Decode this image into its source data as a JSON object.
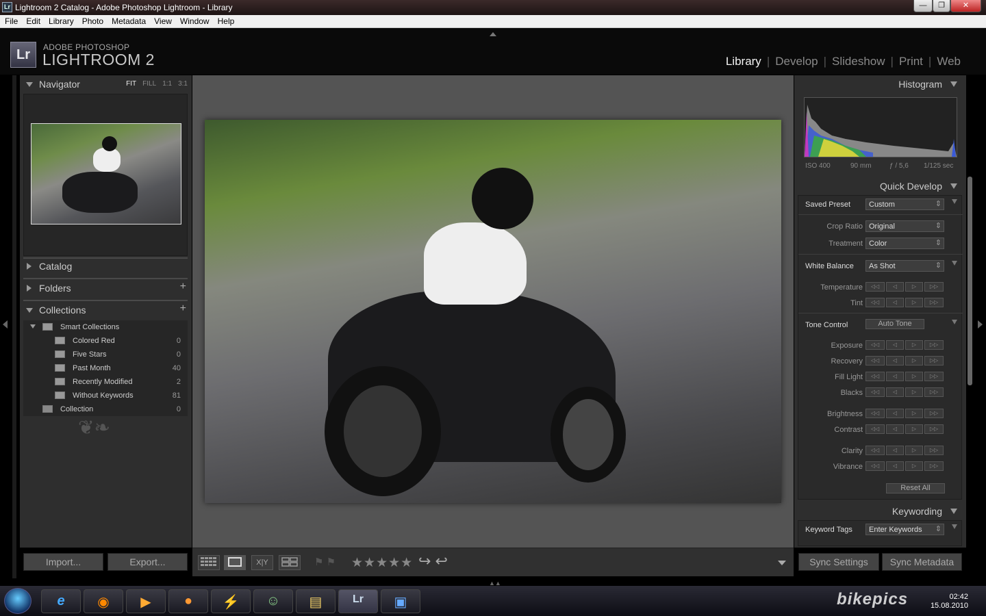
{
  "window": {
    "app_icon": "Lr",
    "title": "Lightroom 2 Catalog - Adobe Photoshop Lightroom - Library",
    "buttons": {
      "minimize": "—",
      "maximize": "❐",
      "close": "✕"
    }
  },
  "menu": [
    "File",
    "Edit",
    "Library",
    "Photo",
    "Metadata",
    "View",
    "Window",
    "Help"
  ],
  "brand": {
    "logo": "Lr",
    "line1": "ADOBE PHOTOSHOP",
    "line2": "LIGHTROOM 2"
  },
  "modules": {
    "library": "Library",
    "develop": "Develop",
    "slideshow": "Slideshow",
    "print": "Print",
    "web": "Web",
    "active": "Library"
  },
  "left_panel": {
    "navigator": {
      "label": "Navigator",
      "zoom": {
        "fit": "FIT",
        "fill": "FILL",
        "one": "1:1",
        "three": "3:1"
      }
    },
    "catalog": {
      "label": "Catalog"
    },
    "folders": {
      "label": "Folders",
      "plus": "+"
    },
    "collections": {
      "label": "Collections",
      "plus": "+",
      "smart": {
        "label": "Smart Collections"
      },
      "items": [
        {
          "name": "Colored Red",
          "count": "0"
        },
        {
          "name": "Five Stars",
          "count": "0"
        },
        {
          "name": "Past Month",
          "count": "40"
        },
        {
          "name": "Recently Modified",
          "count": "2"
        },
        {
          "name": "Without Keywords",
          "count": "81"
        }
      ],
      "plain": {
        "name": "Collection",
        "count": "0"
      }
    },
    "ornament": "❦❧",
    "import_label": "Import...",
    "export_label": "Export..."
  },
  "toolbar": {
    "stars": "★★★★★",
    "flags": "⚑ ⚑",
    "rotate": "↪ ↩",
    "grid_icon": "grid-view-icon",
    "loupe_icon": "loupe-view-icon",
    "compare_label": "X|Y",
    "survey_icon": "survey-view-icon"
  },
  "right_panel": {
    "histogram": {
      "label": "Histogram",
      "iso": "ISO 400",
      "focal": "90 mm",
      "aperture": "ƒ / 5,6",
      "shutter": "1/125 sec"
    },
    "quick_develop": {
      "label": "Quick Develop",
      "saved_preset": {
        "label": "Saved Preset",
        "value": "Custom"
      },
      "crop_ratio": {
        "label": "Crop Ratio",
        "value": "Original"
      },
      "treatment": {
        "label": "Treatment",
        "value": "Color"
      },
      "white_balance": {
        "label": "White Balance",
        "value": "As Shot"
      },
      "temperature": "Temperature",
      "tint": "Tint",
      "tone_control": {
        "label": "Tone Control",
        "auto": "Auto Tone"
      },
      "exposure": "Exposure",
      "recovery": "Recovery",
      "fill_light": "Fill Light",
      "blacks": "Blacks",
      "brightness": "Brightness",
      "contrast": "Contrast",
      "clarity": "Clarity",
      "vibrance": "Vibrance",
      "reset": "Reset All"
    },
    "keywording": {
      "label": "Keywording",
      "tags_label": "Keyword Tags",
      "tags_value": "Enter Keywords"
    },
    "sync_settings": "Sync Settings",
    "sync_metadata": "Sync Metadata"
  },
  "taskbar": {
    "apps": [
      {
        "name": "internet-explorer-icon",
        "glyph": "e"
      },
      {
        "name": "firefox-icon",
        "glyph": "◉"
      },
      {
        "name": "media-player-icon",
        "glyph": "▶"
      },
      {
        "name": "messenger-icon",
        "glyph": "●"
      },
      {
        "name": "winamp-icon",
        "glyph": "⚡"
      },
      {
        "name": "contacts-icon",
        "glyph": "☺"
      },
      {
        "name": "explorer-icon",
        "glyph": "▤"
      },
      {
        "name": "lightroom-icon",
        "glyph": "Lr"
      },
      {
        "name": "photo-viewer-icon",
        "glyph": "▣"
      }
    ],
    "watermark": "bikepics",
    "time": "02:42",
    "date": "15.08.2010"
  },
  "colors": {
    "accent": "#f2f2f2",
    "panel": "#2e2e2e",
    "center": "#545454"
  }
}
